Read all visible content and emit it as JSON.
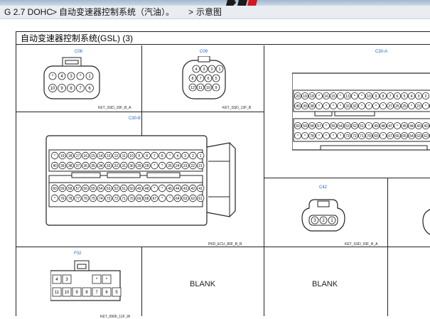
{
  "header": {
    "model": "G 2.7 DOHC",
    "sep": ">",
    "path_1": "自动变速器控制系统（汽油）。",
    "path_2": "示意图"
  },
  "sheet": {
    "title": "自动变速器控制系统(GSL) (3)"
  },
  "connectors": [
    {
      "id": "C08",
      "code": "KET_SSD_10F_B_A",
      "pins_top": [
        "*",
        "4",
        "3",
        "*",
        "1"
      ],
      "pins_bottom": [
        "10",
        "9",
        "8",
        "7",
        "6"
      ]
    },
    {
      "id": "C09",
      "code": "KET_SSD_12F_B",
      "pins_row1": [
        "4",
        "3",
        "2",
        "1"
      ],
      "pins_row2": [
        "8",
        "7",
        "6",
        "5"
      ],
      "pins_row3": [
        "12",
        "11",
        "10",
        "9"
      ]
    },
    {
      "id": "C30-A",
      "code": ""
    },
    {
      "id": "C30-B",
      "code": "PKD_ECU_80F_B_R"
    },
    {
      "id": "C42",
      "code": "KET_SSD_03F_B_A",
      "pins": [
        "3",
        "2",
        "1"
      ]
    },
    {
      "id": "F02",
      "code": "KET_090II_11F_W",
      "pins_top": [
        "4",
        "3",
        "",
        "",
        "*",
        "*"
      ],
      "pins_bottom": [
        "11",
        "10",
        "9",
        "8",
        "7",
        "6",
        "5"
      ]
    }
  ],
  "c30a_rows": [
    "20 19 18 * 16 15 * 13 * * 10 9 8 7 6 5 4 3 2",
    "40 39 38 * * * * 33 32 * * * * 27 26 25 * 23 * 21",
    "60 59 58 57 * 55 54 53 52 51 * 49 48 47 * 45 44 43 42 41",
    "* * 78 * * * * 73 72 71 70 69 * 67 66 65 64 63 62 61"
  ],
  "c30b_rows": [
    "* 19 18 17 16 15 14 13 12 11 10 9 8 7 6 * 4 3 2 1",
    "40 39 38 37 36 35 34 33 32 31 30 29 28 * * 25 24 23 22 21",
    "60 59 58 57 56 55 54 53 52 51 50 49 48 * * 45 44 43 42 41",
    "* 79 78 77 76 75 74 73 72 71 70 69 68 67 * * 64 63 62 61"
  ],
  "blank_label": "BLANK"
}
